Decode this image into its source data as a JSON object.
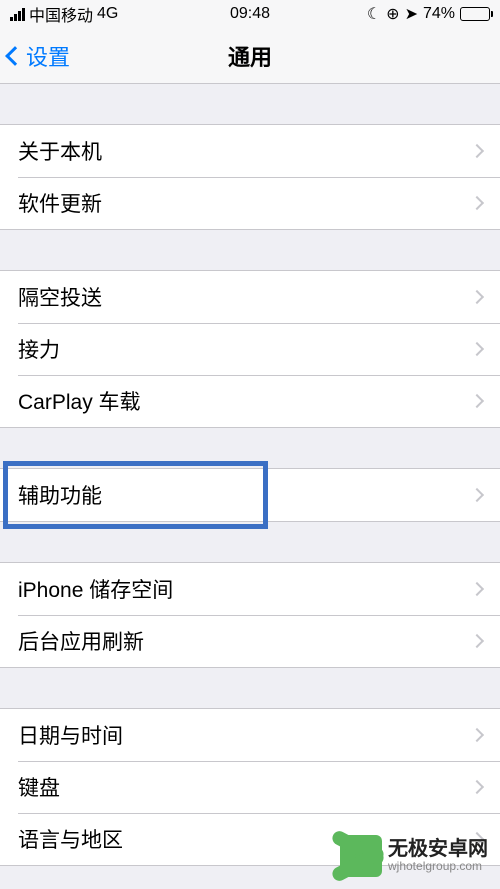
{
  "status": {
    "carrier": "中国移动",
    "network": "4G",
    "time": "09:48",
    "battery_pct": "74%"
  },
  "nav": {
    "back_label": "设置",
    "title": "通用"
  },
  "groups": [
    {
      "rows": [
        {
          "label": "关于本机"
        },
        {
          "label": "软件更新"
        }
      ]
    },
    {
      "rows": [
        {
          "label": "隔空投送"
        },
        {
          "label": "接力"
        },
        {
          "label": "CarPlay 车载"
        }
      ]
    },
    {
      "rows": [
        {
          "label": "辅助功能",
          "highlighted": true
        }
      ]
    },
    {
      "rows": [
        {
          "label": "iPhone 储存空间"
        },
        {
          "label": "后台应用刷新"
        }
      ]
    },
    {
      "rows": [
        {
          "label": "日期与时间"
        },
        {
          "label": "键盘"
        },
        {
          "label": "语言与地区"
        }
      ]
    }
  ],
  "watermark": {
    "title": "无极安卓网",
    "sub": "wjhotelgroup.com"
  }
}
